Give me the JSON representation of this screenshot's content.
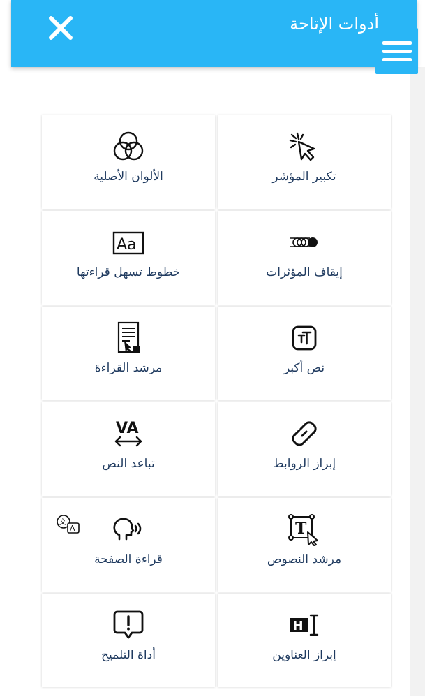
{
  "colors": {
    "accent": "#29b6f6",
    "text": "#1f3a5f"
  },
  "header": {
    "title": "أدوات الإتاحة",
    "close_icon": "close-icon",
    "menu_icon": "hamburger-icon"
  },
  "tiles": [
    {
      "label": "تكبير المؤشر",
      "icon": "cursor-enlarge-icon"
    },
    {
      "label": "الألوان الأصلية",
      "icon": "color-circles-icon"
    },
    {
      "label": "إيقاف المؤثرات",
      "icon": "stop-animations-icon"
    },
    {
      "label": "خطوط تسهل قراءتها",
      "icon": "readable-font-icon"
    },
    {
      "label": "نص أكبر",
      "icon": "bigger-text-icon"
    },
    {
      "label": "مرشد القراءة",
      "icon": "reading-guide-icon"
    },
    {
      "label": "إبراز الروابط",
      "icon": "link-icon"
    },
    {
      "label": "تباعد النص",
      "icon": "text-spacing-icon"
    },
    {
      "label": "مرشد النصوص",
      "icon": "text-guide-icon"
    },
    {
      "label": "قراءة الصفحة",
      "icon": "read-page-icon"
    },
    {
      "label": "إبراز العناوين",
      "icon": "highlight-headings-icon"
    },
    {
      "label": "أداة التلميح",
      "icon": "tooltip-icon"
    }
  ]
}
